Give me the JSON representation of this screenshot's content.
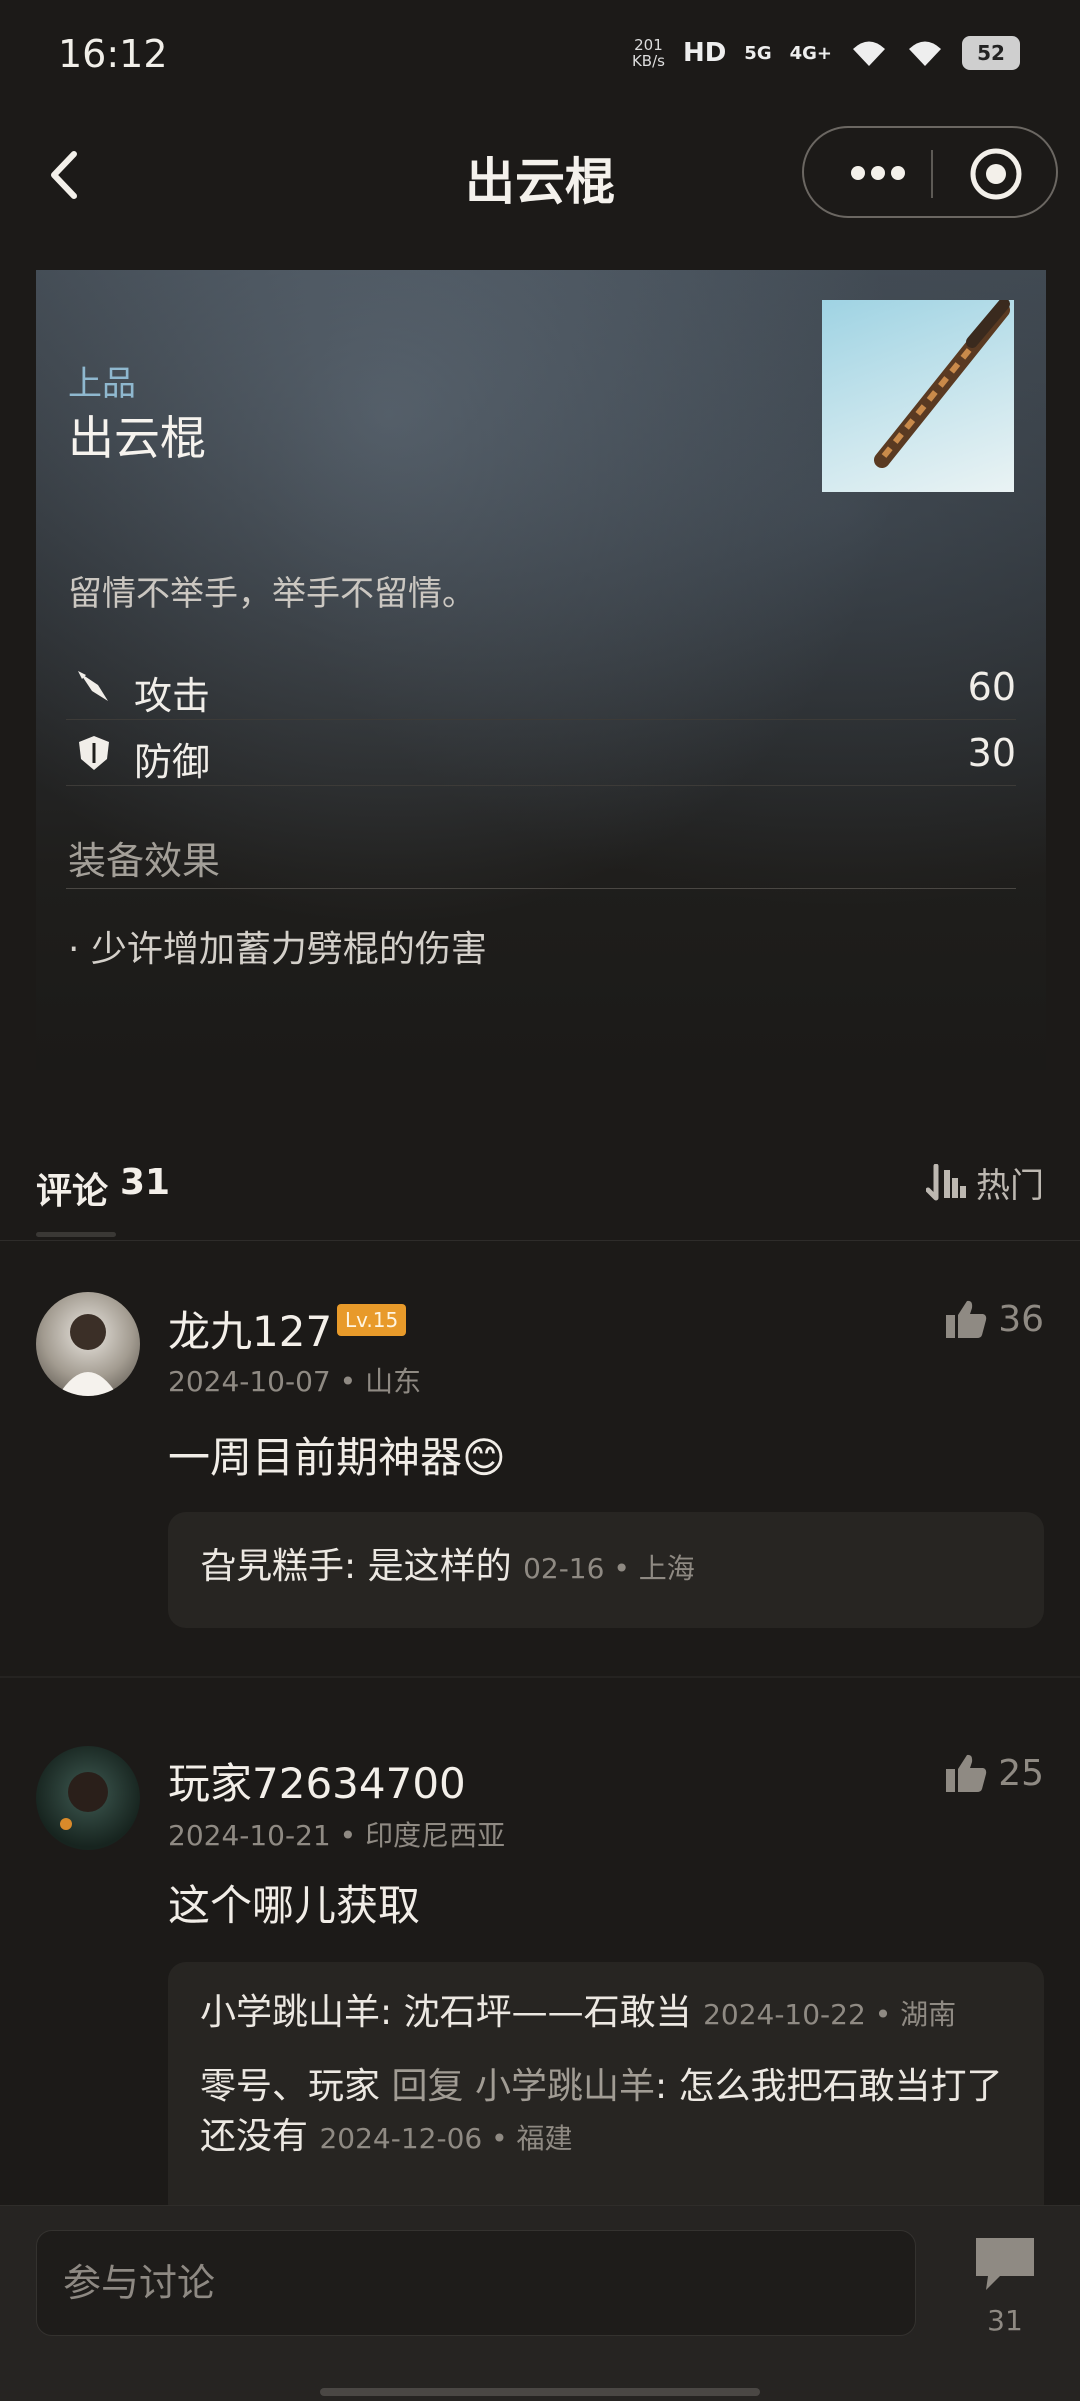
{
  "status": {
    "time": "16:12",
    "net_speed": "201",
    "net_unit": "KB/s",
    "hd": "HD",
    "signal_5g": "5G",
    "signal_4g": "4G+",
    "battery": "52"
  },
  "nav": {
    "title": "出云棍"
  },
  "item": {
    "grade": "上品",
    "name": "出云棍",
    "flavor": "留情不举手，举手不留情。",
    "stats": [
      {
        "label": "攻击",
        "value": "60",
        "icon": "sword-icon"
      },
      {
        "label": "防御",
        "value": "30",
        "icon": "shield-icon"
      }
    ],
    "effects_title": "装备效果",
    "effects": [
      "· 少许增加蓄力劈棍的伤害"
    ]
  },
  "comments_header": {
    "title": "评论",
    "count": "31",
    "sort_label": "热门"
  },
  "comments": [
    {
      "name": "龙九127",
      "level": "Lv.15",
      "date": "2024-10-07",
      "location": "山东",
      "text": "一周目前期神器",
      "emoji": "😊",
      "likes": "36",
      "replies": [
        {
          "user": "旮旯糕手",
          "text": "是这样的",
          "date": "02-16",
          "location": "上海"
        }
      ]
    },
    {
      "name": "玩家72634700",
      "date": "2024-10-21",
      "location": "印度尼西亚",
      "text": "这个哪儿获取",
      "likes": "25",
      "replies": [
        {
          "user": "小学跳山羊",
          "text": "沈石坪——石敢当",
          "date": "2024-10-22",
          "location": "湖南"
        },
        {
          "user": "零号、玩家",
          "reply_word": "回复",
          "reply_to": "小学跳山羊",
          "text": "怎么我把石敢当打了还没有",
          "date": "2024-12-06",
          "location": "福建"
        }
      ]
    }
  ],
  "bottom": {
    "input_placeholder": "参与讨论",
    "comment_count": "31"
  }
}
